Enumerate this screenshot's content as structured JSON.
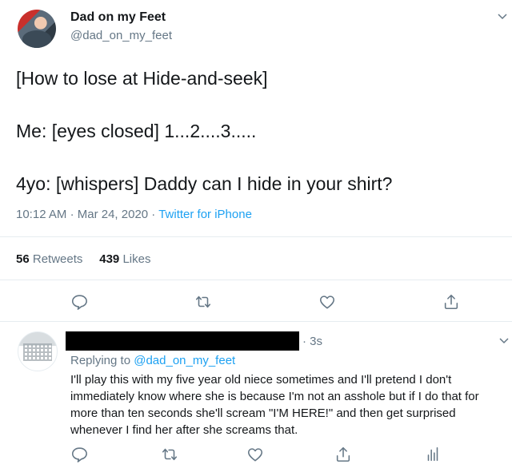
{
  "tweet": {
    "display_name": "Dad on my Feet",
    "handle": "@dad_on_my_feet",
    "text": "[How to lose at Hide-and-seek]\n\nMe: [eyes closed] 1...2....3.....\n\n4yo: [whispers] Daddy can I hide in your shirt?",
    "time": "10:12 AM",
    "date": "Mar 24, 2020",
    "separator": "·",
    "source": "Twitter for iPhone",
    "retweets_count": "56",
    "retweets_label": "Retweets",
    "likes_count": "439",
    "likes_label": "Likes"
  },
  "actions": [
    "reply-icon",
    "retweet-icon",
    "like-icon",
    "share-icon"
  ],
  "reply": {
    "time": "· 3s",
    "replying_prefix": "Replying to",
    "replying_to": "@dad_on_my_feet",
    "text": "I'll play this with my five year old niece sometimes and I'll pretend I don't immediately know where she is because I'm not an asshole but if I do that for more than ten seconds she'll scream \"I'M HERE!\" and then get surprised whenever I find her after she screams that."
  },
  "colors": {
    "text": "#14171a",
    "secondary": "#657786",
    "accent": "#1da1f2",
    "divider": "#e6ecf0"
  }
}
